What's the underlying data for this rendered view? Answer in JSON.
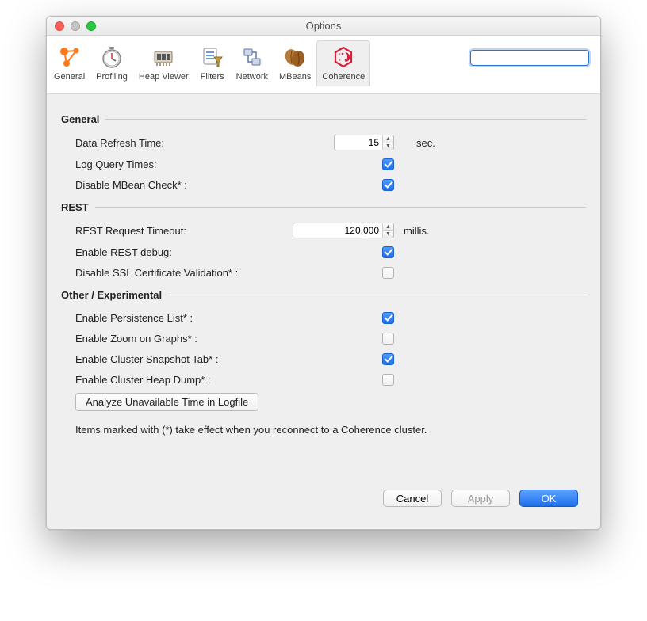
{
  "window": {
    "title": "Options"
  },
  "toolbar": {
    "tabs": [
      {
        "label": "General"
      },
      {
        "label": "Profiling"
      },
      {
        "label": "Heap Viewer"
      },
      {
        "label": "Filters"
      },
      {
        "label": "Network"
      },
      {
        "label": "MBeans"
      },
      {
        "label": "Coherence"
      }
    ],
    "search_placeholder": ""
  },
  "sections": {
    "general": {
      "title": "General",
      "refresh_label": "Data Refresh Time:",
      "refresh_value": "15",
      "refresh_unit": "sec.",
      "log_query_label": "Log Query Times:",
      "disable_mbean_label": "Disable MBean Check* :"
    },
    "rest": {
      "title": "REST",
      "timeout_label": "REST Request Timeout:",
      "timeout_value": "120,000",
      "timeout_unit": "millis.",
      "enable_debug_label": "Enable REST debug:",
      "disable_ssl_label": "Disable SSL Certificate Validation* :"
    },
    "other": {
      "title": "Other / Experimental",
      "persistence_label": "Enable Persistence List* :",
      "zoom_label": "Enable Zoom on Graphs* :",
      "snapshot_label": "Enable Cluster Snapshot Tab* :",
      "heapdump_label": "Enable Cluster Heap Dump* :",
      "analyze_button": "Analyze Unavailable Time in Logfile"
    },
    "footnote": "Items marked with (*) take effect when you reconnect to a Coherence cluster."
  },
  "footer": {
    "cancel": "Cancel",
    "apply": "Apply",
    "ok": "OK"
  }
}
